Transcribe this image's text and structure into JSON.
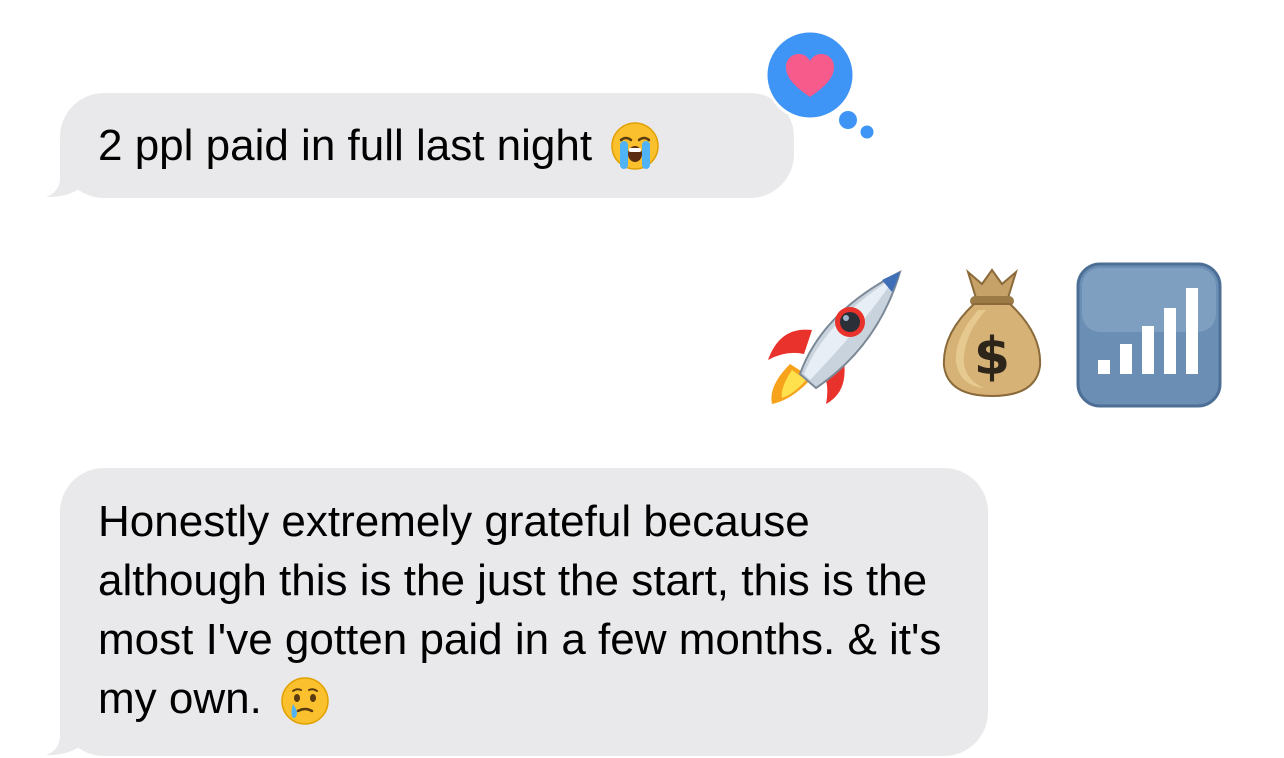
{
  "conversation": {
    "messages": [
      {
        "sender": "received",
        "text": "2 ppl paid in full last night",
        "emoji": "loudly-crying-face",
        "reaction": "heart"
      },
      {
        "sender": "sent",
        "emojis": [
          "rocket",
          "money-bag",
          "signal-bars"
        ]
      },
      {
        "sender": "received",
        "text": "Honestly extremely grateful because although this is the just the start, this is the most I've gotten paid in a few months. & it's my own.",
        "emoji": "face-holding-back-tears"
      }
    ]
  },
  "colors": {
    "received_bubble": "#e9e9eb",
    "tapback_blue": "#3e95f5",
    "heart_pink": "#f65b8c"
  }
}
